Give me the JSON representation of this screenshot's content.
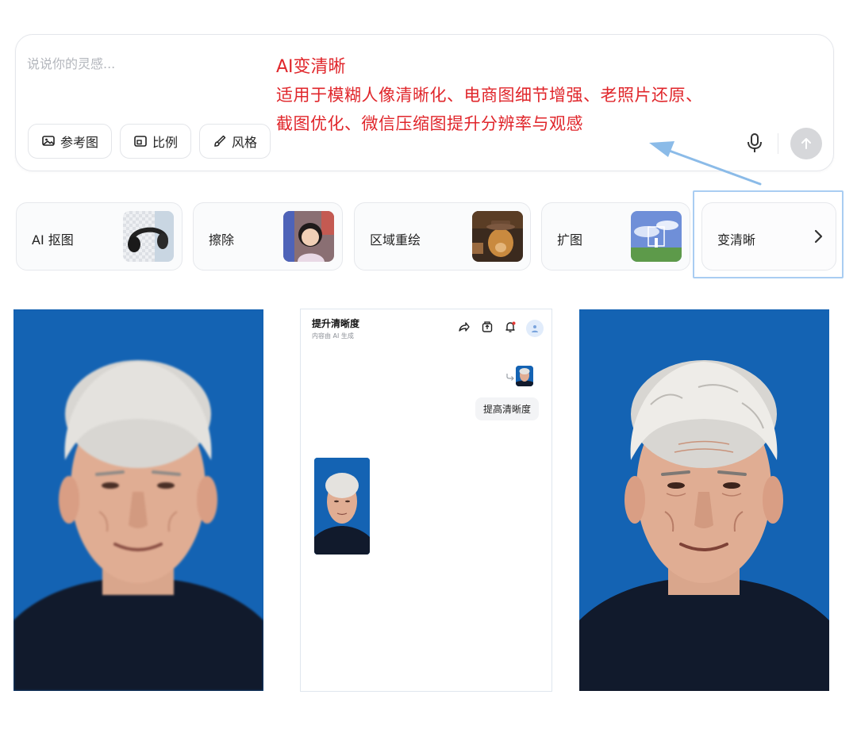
{
  "prompt": {
    "placeholder": "说说你的灵感...",
    "chips": [
      {
        "label": "参考图",
        "icon": "image-reference-icon"
      },
      {
        "label": "比例",
        "icon": "aspect-ratio-icon"
      },
      {
        "label": "风格",
        "icon": "brush-icon"
      }
    ]
  },
  "annotation": {
    "title": "AI变清晰",
    "line1": "适用于模糊人像清晰化、电商图细节增强、老照片还原、",
    "line2": "截图优化、微信压缩图提升分辨率与观感",
    "color": "#e0262b"
  },
  "tools": [
    {
      "label": "AI 抠图",
      "thumb": "headphones-cutout"
    },
    {
      "label": "擦除",
      "thumb": "girl-portrait"
    },
    {
      "label": "区域重绘",
      "thumb": "dog-with-hat"
    },
    {
      "label": "扩图",
      "thumb": "landscape-sky"
    },
    {
      "label": "变清晰",
      "thumb": "blank"
    }
  ],
  "phone": {
    "title": "提升清晰度",
    "subtitle": "内容由 AI 生成",
    "user_message": "提高清晰度",
    "header_icons": [
      "share-icon",
      "export-icon",
      "bell-icon",
      "user-avatar-icon"
    ]
  },
  "colors": {
    "photo_background": "#1560b0",
    "highlight": "#a9cdf2",
    "arrow": "#8bbbe8"
  }
}
